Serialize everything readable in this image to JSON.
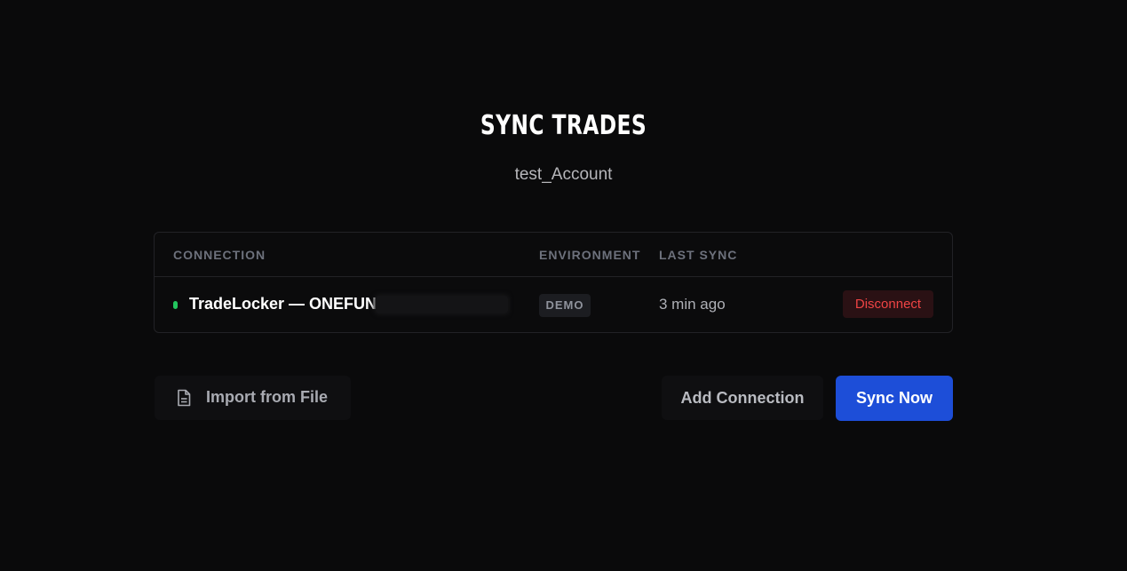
{
  "header": {
    "title": "SYNC TRADES",
    "account": "test_Account"
  },
  "table": {
    "columns": {
      "connection": "CONNECTION",
      "environment": "ENVIRONMENT",
      "last_sync": "LAST SYNC"
    },
    "rows": [
      {
        "status_color": "#22c55e",
        "connection": "TradeLocker — ONEFUND",
        "environment": "DEMO",
        "last_sync": "3 min ago",
        "action_label": "Disconnect"
      }
    ]
  },
  "actions": {
    "import_label": "Import from File",
    "import_icon": "file-icon",
    "add_label": "Add Connection",
    "sync_label": "Sync Now"
  },
  "colors": {
    "background": "#0a0a0b",
    "accent": "#1d4ed8",
    "danger": "#ef4444",
    "status_ok": "#22c55e"
  }
}
